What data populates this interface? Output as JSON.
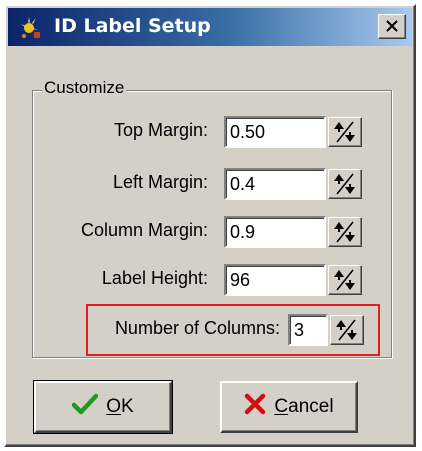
{
  "window": {
    "title": "ID Label Setup"
  },
  "group": {
    "label": "Customize"
  },
  "fields": [
    {
      "label": "Top Margin:",
      "value": "0.50"
    },
    {
      "label": "Left Margin:",
      "value": "0.4"
    },
    {
      "label": "Column Margin:",
      "value": "0.9"
    },
    {
      "label": "Label Height:",
      "value": "96"
    },
    {
      "label": "Number of Columns:",
      "value": "3"
    }
  ],
  "buttons": {
    "ok": {
      "label_first": "O",
      "label_rest": "K"
    },
    "cancel": {
      "label_first": "C",
      "label_rest": "ancel"
    }
  },
  "icons": {
    "title": "app-sparkle-icon",
    "close": "close-icon",
    "spin": "spin-arrows-icon",
    "ok": "checkmark-icon",
    "cancel": "x-mark-icon"
  },
  "colors": {
    "title_start": "#0a246a",
    "title_end": "#a6caf0",
    "highlight": "#e02020",
    "ok_icon": "#1f9a1f",
    "cancel_icon": "#d01010"
  }
}
